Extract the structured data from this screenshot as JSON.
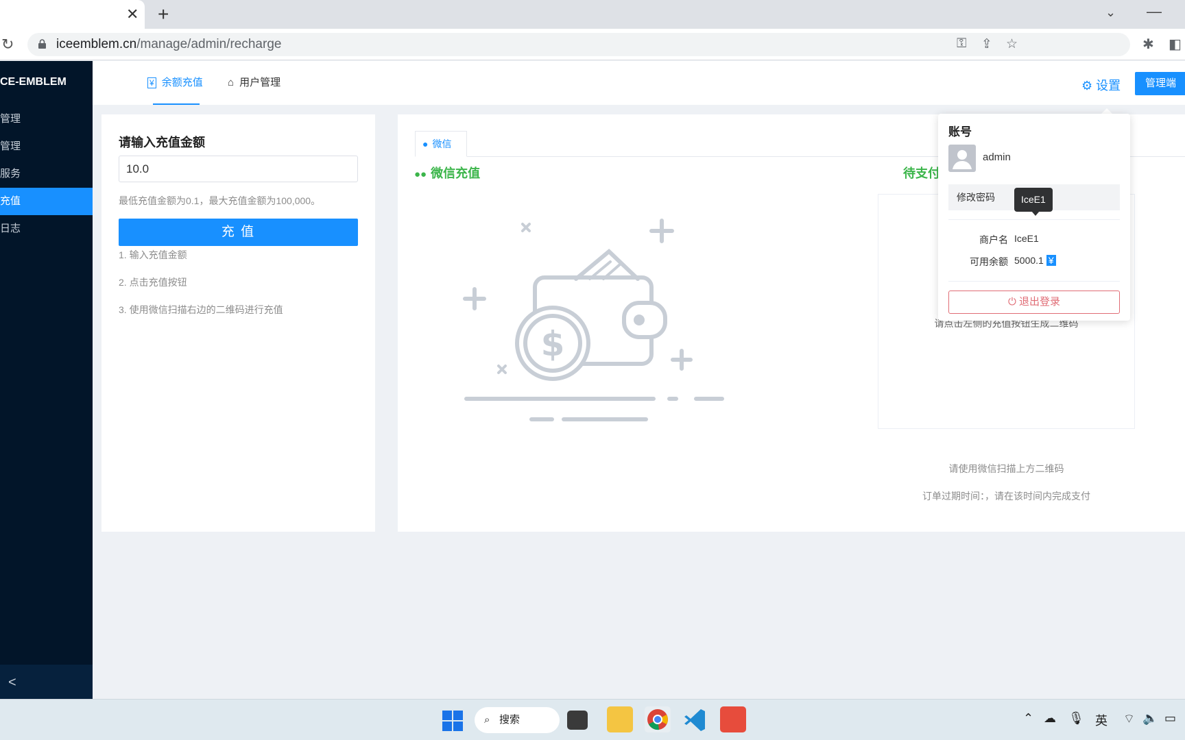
{
  "browser": {
    "tab_close": "✕",
    "new_tab": "+",
    "url_host": "iceemblem.cn",
    "url_path": "/manage/admin/recharge"
  },
  "sidebar": {
    "logo": "CE-EMBLEM",
    "items": [
      {
        "label": "管理"
      },
      {
        "label": "管理"
      },
      {
        "label": "服务"
      },
      {
        "label": "充值",
        "active": true
      },
      {
        "label": "日志"
      }
    ],
    "collapse": "<"
  },
  "header": {
    "tabs": [
      {
        "label": "余额充值",
        "active": true
      },
      {
        "label": "用户管理"
      }
    ],
    "settings": "设置",
    "admin_button": "管理端"
  },
  "recharge_form": {
    "title": "请输入充值金额",
    "amount": "10.0",
    "hint": "最低充值金额为0.1，最大充值金额为100,000。",
    "button": "充 值",
    "steps": [
      "1. 输入充值金额",
      "2. 点击充值按钮",
      "3. 使用微信扫描右边的二维码进行充值"
    ]
  },
  "payment": {
    "tab": "微信",
    "title": "微信充值",
    "pending": "待支付",
    "qr_message": "请点击左侧的充值按钮生成二维码",
    "scan_hint": "请使用微信扫描上方二维码",
    "expire": "订单过期时间：，请在该时间内完成支付"
  },
  "account_popover": {
    "title": "账号",
    "username": "admin",
    "change_password": "修改密码",
    "tooltip": "IceE1",
    "merchant_label": "商户名",
    "merchant_value": "IceE1",
    "balance_label": "可用余额",
    "balance_value": "5000.1",
    "currency": "¥",
    "logout": "退出登录"
  },
  "taskbar": {
    "search": "搜索",
    "ime": "英"
  },
  "colors": {
    "primary": "#1890ff",
    "sidebar": "#021529",
    "wechat_green": "#3bb54a",
    "logout_red": "#e06c75"
  }
}
